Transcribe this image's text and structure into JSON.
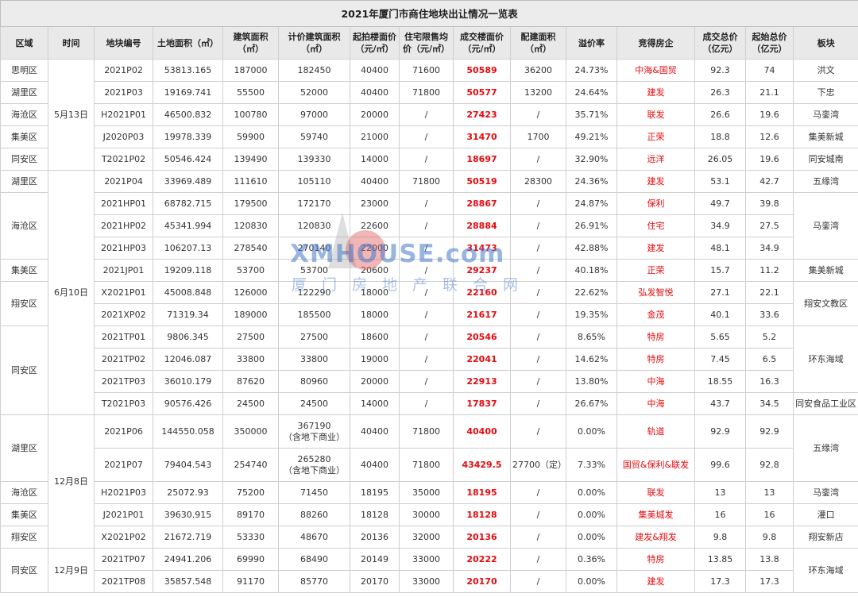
{
  "title": "2021年厦门市商住地块出让情况一览表",
  "headers": [
    "区域",
    "时间",
    "地块编号",
    "土地面积（㎡）",
    "建筑面积（㎡）",
    "计价建筑面积（㎡）",
    "起拍楼面价（元/㎡）",
    "住宅限售均价（元/㎡）",
    "成交楼面价（元/㎡）",
    "配建面积（㎡）",
    "溢价率",
    "竞得房企",
    "成交总价（亿元）",
    "起始总价（亿元）",
    "板块"
  ],
  "groups": [
    {
      "date": "5月13日"
    },
    {
      "date": "6月10日"
    },
    {
      "date": "12月8日"
    },
    {
      "date": "12月9日"
    }
  ],
  "rows": [
    {
      "district": "思明区",
      "code": "2021P02",
      "land": "53813.165",
      "build": "187000",
      "priced": "182450",
      "start_price": "40400",
      "limit": "71600",
      "deal": "50589",
      "extra": "36200",
      "premium": "24.73%",
      "dev": "中海&国贸",
      "total": "92.3",
      "start_total": "74",
      "board": "洪文"
    },
    {
      "district": "湖里区",
      "code": "2021P03",
      "land": "19169.741",
      "build": "55500",
      "priced": "52000",
      "start_price": "40400",
      "limit": "71800",
      "deal": "50577",
      "extra": "13200",
      "premium": "24.64%",
      "dev": "建发",
      "total": "26.3",
      "start_total": "21.1",
      "board": "下忠"
    },
    {
      "district": "海沧区",
      "code": "H2021P01",
      "land": "46500.832",
      "build": "100780",
      "priced": "97000",
      "start_price": "20000",
      "limit": "/",
      "deal": "27423",
      "extra": "/",
      "premium": "35.71%",
      "dev": "联发",
      "total": "26.6",
      "start_total": "19.6",
      "board": "马銮湾"
    },
    {
      "district": "集美区",
      "code": "J2020P03",
      "land": "19978.339",
      "build": "59900",
      "priced": "59740",
      "start_price": "21000",
      "limit": "/",
      "deal": "31470",
      "extra": "1700",
      "premium": "49.21%",
      "dev": "正荣",
      "total": "18.8",
      "start_total": "12.6",
      "board": "集美新城"
    },
    {
      "district": "同安区",
      "code": "T2021P02",
      "land": "50546.424",
      "build": "139490",
      "priced": "139330",
      "start_price": "14000",
      "limit": "/",
      "deal": "18697",
      "extra": "/",
      "premium": "32.90%",
      "dev": "远洋",
      "total": "26.05",
      "start_total": "19.6",
      "board": "同安城南"
    },
    {
      "district": "湖里区",
      "code": "2021P04",
      "land": "33969.489",
      "build": "111610",
      "priced": "105110",
      "start_price": "40400",
      "limit": "71800",
      "deal": "50519",
      "extra": "28300",
      "premium": "24.36%",
      "dev": "建发",
      "total": "53.1",
      "start_total": "42.7",
      "board": "五缘湾"
    },
    {
      "district": "海沧区",
      "code": "2021HP01",
      "land": "68782.715",
      "build": "179500",
      "priced": "172170",
      "start_price": "23000",
      "limit": "/",
      "deal": "28867",
      "extra": "/",
      "premium": "24.87%",
      "dev": "保利",
      "total": "49.7",
      "start_total": "39.8",
      "board": "马銮湾"
    },
    {
      "code": "2021HP02",
      "land": "45341.994",
      "build": "120830",
      "priced": "120830",
      "start_price": "22600",
      "limit": "/",
      "deal": "28884",
      "extra": "/",
      "premium": "26.91%",
      "dev": "住宅",
      "total": "34.9",
      "start_total": "27.5"
    },
    {
      "code": "2021HP03",
      "land": "106207.13",
      "build": "278540",
      "priced": "270140",
      "start_price": "22000",
      "limit": "/",
      "deal": "31473",
      "extra": "/",
      "premium": "42.88%",
      "dev": "建发",
      "total": "48.1",
      "start_total": "34.9"
    },
    {
      "district": "集美区",
      "code": "2021JP01",
      "land": "19209.118",
      "build": "53700",
      "priced": "53700",
      "start_price": "20600",
      "limit": "/",
      "deal": "29237",
      "extra": "/",
      "premium": "40.18%",
      "dev": "正荣",
      "total": "15.7",
      "start_total": "11.2",
      "board": "集美新城"
    },
    {
      "district": "翔安区",
      "code": "X2021P01",
      "land": "45008.848",
      "build": "126000",
      "priced": "122290",
      "start_price": "18000",
      "limit": "/",
      "deal": "22160",
      "extra": "/",
      "premium": "22.62%",
      "dev": "弘发智悦",
      "total": "27.1",
      "start_total": "22.1",
      "board": "翔安文教区"
    },
    {
      "code": "2021XP02",
      "land": "71319.34",
      "build": "189000",
      "priced": "185500",
      "start_price": "18000",
      "limit": "/",
      "deal": "21617",
      "extra": "/",
      "premium": "19.35%",
      "dev": "金茂",
      "total": "40.1",
      "start_total": "33.6"
    },
    {
      "district": "同安区",
      "code": "2021TP01",
      "land": "9806.345",
      "build": "27500",
      "priced": "27500",
      "start_price": "18600",
      "limit": "/",
      "deal": "20546",
      "extra": "/",
      "premium": "8.65%",
      "dev": "特房",
      "total": "5.65",
      "start_total": "5.2",
      "board": "环东海域"
    },
    {
      "code": "2021TP02",
      "land": "12046.087",
      "build": "33800",
      "priced": "33800",
      "start_price": "19000",
      "limit": "/",
      "deal": "22041",
      "extra": "/",
      "premium": "14.62%",
      "dev": "特房",
      "total": "7.45",
      "start_total": "6.5"
    },
    {
      "code": "2021TP03",
      "land": "36010.179",
      "build": "87620",
      "priced": "80960",
      "start_price": "20000",
      "limit": "/",
      "deal": "22913",
      "extra": "/",
      "premium": "13.80%",
      "dev": "中海",
      "total": "18.55",
      "start_total": "16.3"
    },
    {
      "code": "T2021P03",
      "land": "90576.426",
      "build": "24500",
      "priced": "24500",
      "start_price": "14000",
      "limit": "/",
      "deal": "17837",
      "extra": "/",
      "premium": "26.67%",
      "dev": "中海",
      "total": "43.7",
      "start_total": "34.5",
      "board": "同安食品工业区"
    },
    {
      "district": "湖里区",
      "code": "2021P06",
      "land": "144550.058",
      "build": "350000",
      "priced": "367190",
      "priced_note": "（含地下商业）",
      "start_price": "40400",
      "limit": "71800",
      "deal": "40400",
      "extra": "/",
      "premium": "0.00%",
      "dev": "轨道",
      "total": "92.9",
      "start_total": "92.9",
      "board": "五缘湾"
    },
    {
      "code": "2021P07",
      "land": "79404.543",
      "build": "254740",
      "priced": "265280",
      "priced_note": "（含地下商业）",
      "start_price": "40400",
      "limit": "71800",
      "deal": "43429.5",
      "extra": "27700（定）",
      "premium": "7.33%",
      "dev": "国贸&保利&联发",
      "total": "99.6",
      "start_total": "92.8"
    },
    {
      "district": "海沧区",
      "code": "H2021P03",
      "land": "25072.93",
      "build": "75200",
      "priced": "71450",
      "start_price": "18195",
      "limit": "35000",
      "deal": "18195",
      "extra": "/",
      "premium": "0.00%",
      "dev": "联发",
      "total": "13",
      "start_total": "13",
      "board": "马銮湾"
    },
    {
      "district": "集美区",
      "code": "J2021P01",
      "land": "39630.915",
      "build": "89170",
      "priced": "88260",
      "start_price": "18128",
      "limit": "30000",
      "deal": "18128",
      "extra": "/",
      "premium": "0.00%",
      "dev": "集美城发",
      "total": "16",
      "start_total": "16",
      "board": "灌口"
    },
    {
      "district": "翔安区",
      "code": "X2021P02",
      "land": "21672.719",
      "build": "53330",
      "priced": "48670",
      "start_price": "20136",
      "limit": "32000",
      "deal": "20136",
      "extra": "/",
      "premium": "0.00%",
      "dev": "建发&翔发",
      "total": "9.8",
      "start_total": "9.8",
      "board": "翔安新店"
    },
    {
      "district": "同安区",
      "code": "2021TP07",
      "land": "24941.206",
      "build": "69990",
      "priced": "68490",
      "start_price": "20149",
      "limit": "33000",
      "deal": "20222",
      "extra": "/",
      "premium": "0.36%",
      "dev": "特房",
      "total": "13.85",
      "start_total": "13.8",
      "board": "环东海域"
    },
    {
      "code": "2021TP08",
      "land": "35857.548",
      "build": "91170",
      "priced": "85770",
      "start_price": "20170",
      "limit": "33000",
      "deal": "20170",
      "extra": "/",
      "premium": "0.00%",
      "dev": "建发",
      "total": "17.3",
      "start_total": "17.3"
    }
  ],
  "watermark": {
    "brand": "XMHOUSE.com",
    "sub": "厦门房地产联合网"
  },
  "colors": {
    "header_bg": "#e9e9e9",
    "title_bg": "#ececec",
    "highlight": "#e8090c",
    "border": "#cfcfcf"
  }
}
